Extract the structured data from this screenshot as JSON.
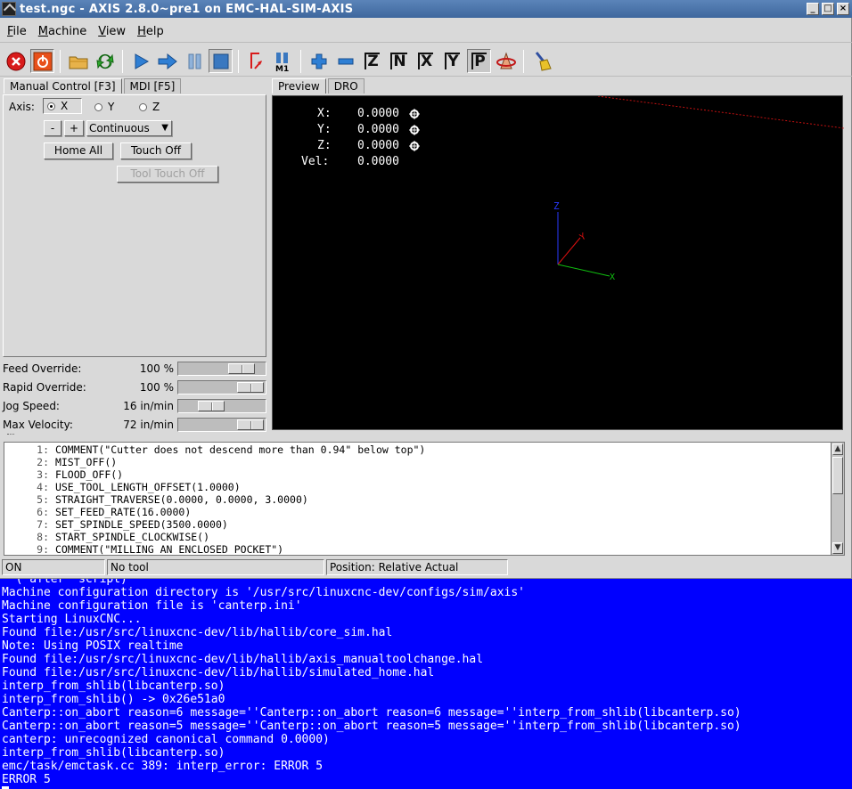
{
  "window": {
    "title": "test.ngc - AXIS 2.8.0~pre1 on EMC-HAL-SIM-AXIS"
  },
  "menu": {
    "items": [
      {
        "ul": "F",
        "rest": "ile"
      },
      {
        "ul": "M",
        "rest": "achine"
      },
      {
        "ul": "V",
        "rest": "iew"
      },
      {
        "ul": "H",
        "rest": "elp"
      }
    ]
  },
  "toolbar": {
    "icons": [
      "estop-icon",
      "power-icon",
      "open-file-icon",
      "reload-icon",
      "run-icon",
      "step-icon",
      "pause-icon",
      "stop-icon",
      "verify-icon",
      "optional-stop-icon",
      "zoom-in-icon",
      "zoom-out-icon",
      "view-z-icon",
      "view-z2-icon",
      "view-x-icon",
      "view-y-icon",
      "view-p-icon",
      "rotate-view-icon",
      "clear-plot-icon"
    ],
    "axis_labels": {
      "z": "Z",
      "z2": "N",
      "x": "X",
      "y": "Y",
      "p": "P"
    },
    "m1_label": "M1"
  },
  "left_tabs": [
    "Manual Control [F3]",
    "MDI [F5]"
  ],
  "manual": {
    "axis_label": "Axis:",
    "axes": [
      "X",
      "Y",
      "Z"
    ],
    "selected_axis": "X",
    "minus": "-",
    "plus": "+",
    "jog_mode": "Continuous",
    "home_all": "Home All",
    "touch_off": "Touch Off",
    "tool_touch_off": "Tool Touch Off"
  },
  "overrides": [
    {
      "label": "Feed Override:",
      "value": "100",
      "unit": "%",
      "level": 0.75
    },
    {
      "label": "Rapid Override:",
      "value": "100",
      "unit": "%",
      "level": 1.0
    },
    {
      "label": "Jog Speed:",
      "value": "16",
      "unit": "in/min",
      "level": 0.35
    },
    {
      "label": "Max Velocity:",
      "value": "72",
      "unit": "in/min",
      "level": 1.0
    }
  ],
  "preview_tabs": [
    "Preview",
    "DRO"
  ],
  "dro": {
    "x_label": "X:",
    "x": "0.0000",
    "y_label": "Y:",
    "y": "0.0000",
    "z_label": "Z:",
    "z": "0.0000",
    "vel_label": "Vel:",
    "vel": "0.0000"
  },
  "origin_axes": {
    "z": "Z",
    "y": "Y",
    "x": "X"
  },
  "gcode": [
    {
      "n": "1:",
      "text": "COMMENT(\"Cutter does not descend more than 0.94\" below top\")"
    },
    {
      "n": "2:",
      "text": "MIST_OFF()"
    },
    {
      "n": "3:",
      "text": "FLOOD_OFF()"
    },
    {
      "n": "4:",
      "text": "USE_TOOL_LENGTH_OFFSET(1.0000)"
    },
    {
      "n": "5:",
      "text": "STRAIGHT_TRAVERSE(0.0000, 0.0000, 3.0000)"
    },
    {
      "n": "6:",
      "text": "SET_FEED_RATE(16.0000)"
    },
    {
      "n": "7:",
      "text": "SET_SPINDLE_SPEED(3500.0000)"
    },
    {
      "n": "8:",
      "text": "START_SPINDLE_CLOCKWISE()"
    },
    {
      "n": "9:",
      "text": "COMMENT(\"MILLING AN ENCLOSED POCKET\")"
    }
  ],
  "status": {
    "state": "ON",
    "tool": "No tool",
    "position": "Position: Relative Actual"
  },
  "terminal": [
    "  ( after  script)",
    "Machine configuration directory is '/usr/src/linuxcnc-dev/configs/sim/axis'",
    "Machine configuration file is 'canterp.ini'",
    "Starting LinuxCNC...",
    "Found file:/usr/src/linuxcnc-dev/lib/hallib/core_sim.hal",
    "Note: Using POSIX realtime",
    "Found file:/usr/src/linuxcnc-dev/lib/hallib/axis_manualtoolchange.hal",
    "Found file:/usr/src/linuxcnc-dev/lib/hallib/simulated_home.hal",
    "interp_from_shlib(libcanterp.so)",
    "interp_from_shlib() -> 0x26e51a0",
    "Canterp::on_abort reason=6 message=''Canterp::on_abort reason=6 message=''interp_from_shlib(libcanterp.so)",
    "Canterp::on_abort reason=5 message=''Canterp::on_abort reason=5 message=''interp_from_shlib(libcanterp.so)",
    "canterp: unrecognized canonical command 0.0000)",
    "interp_from_shlib(libcanterp.so)",
    "emc/task/emctask.cc 389: interp_error: ERROR 5",
    "ERROR 5"
  ]
}
